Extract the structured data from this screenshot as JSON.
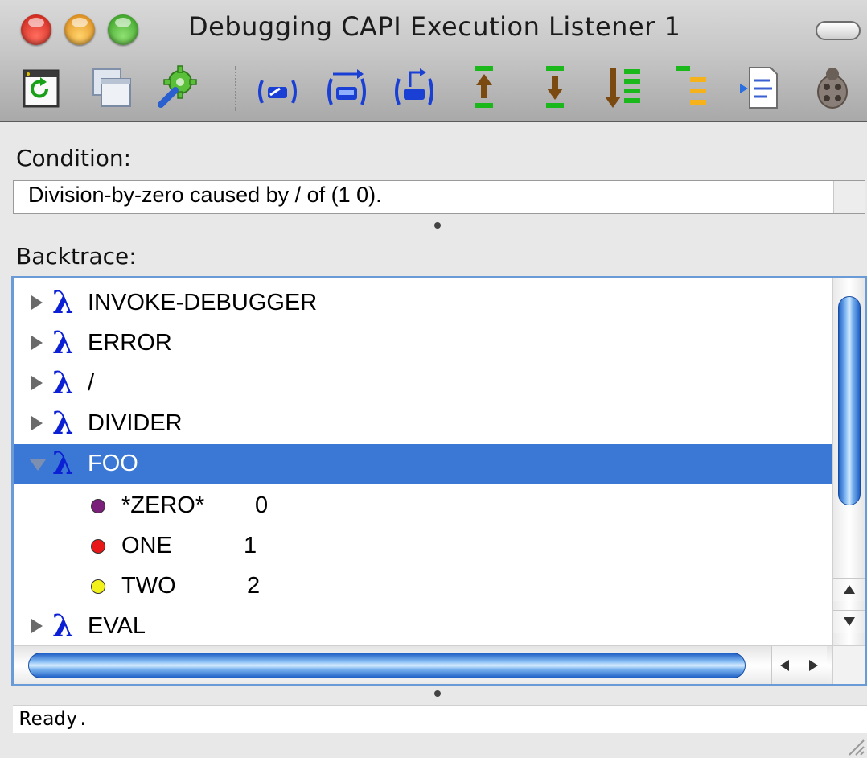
{
  "window": {
    "title": "Debugging CAPI Execution Listener 1"
  },
  "toolbar": {
    "buttons": [
      {
        "name": "refresh",
        "icon": "refresh-icon"
      },
      {
        "name": "windows",
        "icon": "windows-icon"
      },
      {
        "name": "tools",
        "icon": "gear-wrench-icon"
      },
      {
        "name": "restart-frame",
        "icon": "restart-frame-icon"
      },
      {
        "name": "return-from-frame",
        "icon": "return-from-frame-icon"
      },
      {
        "name": "abort",
        "icon": "abort-icon"
      },
      {
        "name": "up-frame",
        "icon": "arrow-up-frame-icon"
      },
      {
        "name": "down-frame",
        "icon": "arrow-down-frame-icon"
      },
      {
        "name": "bottom-frame",
        "icon": "bottom-frame-icon"
      },
      {
        "name": "top-frame",
        "icon": "top-frame-icon"
      },
      {
        "name": "edit-frame",
        "icon": "edit-document-icon"
      },
      {
        "name": "bug",
        "icon": "ladybug-icon"
      }
    ]
  },
  "condition": {
    "label": "Condition:",
    "text": "Division-by-zero caused by / of (1 0)."
  },
  "backtrace": {
    "label": "Backtrace:",
    "frames": [
      {
        "name": "INVOKE-DEBUGGER",
        "expanded": false,
        "selected": false
      },
      {
        "name": "ERROR",
        "expanded": false,
        "selected": false
      },
      {
        "name": "/",
        "expanded": false,
        "selected": false
      },
      {
        "name": "DIVIDER",
        "expanded": false,
        "selected": false
      },
      {
        "name": "FOO",
        "expanded": true,
        "selected": true
      },
      {
        "name": "EVAL",
        "expanded": false,
        "selected": false
      }
    ],
    "variables": [
      {
        "name": "*ZERO*",
        "value": "0",
        "color": "#7a1f7a"
      },
      {
        "name": "ONE",
        "value": "1",
        "color": "#e81818"
      },
      {
        "name": "TWO",
        "value": "2",
        "color": "#f2f21a"
      }
    ],
    "selection_color": "#3b78d6",
    "lambda_color": "#0b1fd4"
  },
  "status": {
    "text": "Ready."
  }
}
